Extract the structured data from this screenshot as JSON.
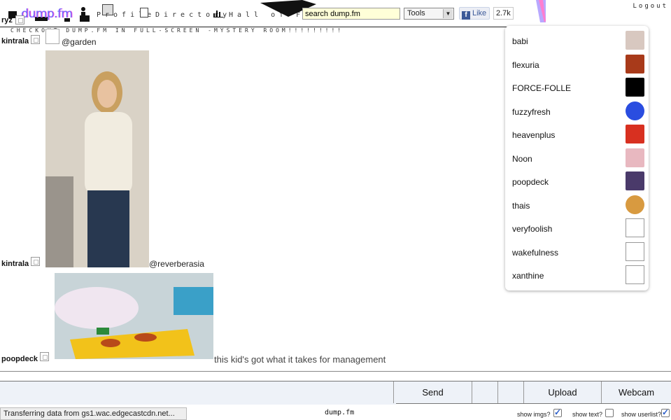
{
  "header": {
    "logo": "dump.fm",
    "nav": [
      {
        "label": "Profile",
        "icon": "person-icon"
      },
      {
        "label": "Directory",
        "icon": "directory-icon"
      },
      {
        "label": "Hall of Fame",
        "icon": "chart-icon"
      }
    ],
    "search_value": "search dump.fm",
    "tools_label": "Tools",
    "fb_like_label": "Like",
    "fb_like_count": "2.7k",
    "logout_label": "Logout",
    "ticker": "CHECKOUT DUMP.FM IN FULL-SCREEN -MYSTERY ROOM!!!!!!!!!"
  },
  "messages": [
    {
      "nick": "ryz",
      "text": ""
    },
    {
      "nick": "kintrala",
      "text": "@garden"
    },
    {
      "nick": "kintrala",
      "text": "@reverberasia"
    },
    {
      "nick": "poopdeck",
      "text": "this kid's got what it takes for management"
    }
  ],
  "userlist": [
    {
      "name": "babi",
      "avatar_color": "#d8c8c0"
    },
    {
      "name": "flexuria",
      "avatar_color": "#a83a1a"
    },
    {
      "name": "FORCE-FOLLE",
      "avatar_color": "#000000"
    },
    {
      "name": "fuzzyfresh",
      "avatar_color": "#2a4de0"
    },
    {
      "name": "heavenplus",
      "avatar_color": "#d83020"
    },
    {
      "name": "Noon",
      "avatar_color": "#e8b8c0"
    },
    {
      "name": "poopdeck",
      "avatar_color": "#4a3a6a"
    },
    {
      "name": "thais",
      "avatar_color": "#d89a40"
    },
    {
      "name": "veryfoolish",
      "avatar_color": ""
    },
    {
      "name": "wakefulness",
      "avatar_color": ""
    },
    {
      "name": "xanthine",
      "avatar_color": ""
    }
  ],
  "composer": {
    "send_label": "Send",
    "upload_label": "Upload",
    "webcam_label": "Webcam"
  },
  "statusbar": {
    "status_text": "Transferring data from gs1.wac.edgecastcdn.net...",
    "center_text": "dump.fm",
    "show_imgs_label": "show imgs?",
    "show_imgs": true,
    "show_text_label": "show text?",
    "show_text": false,
    "show_userlist_label": "show userlist?",
    "show_userlist": true
  }
}
